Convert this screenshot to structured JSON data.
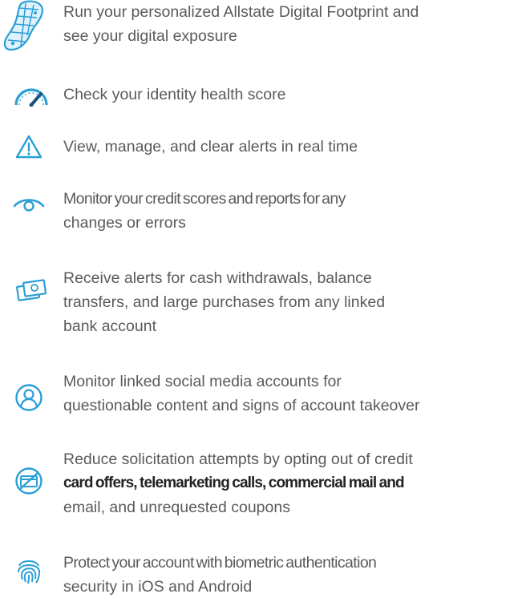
{
  "features": [
    {
      "icon": "digital-footprint-icon",
      "lines": [
        "Run your personalized Allstate Digital Footprint and",
        "see your digital exposure"
      ]
    },
    {
      "icon": "gauge-icon",
      "lines": [
        "Check your identity health score"
      ]
    },
    {
      "icon": "warning-icon",
      "lines": [
        "View, manage, and clear alerts in real time"
      ]
    },
    {
      "icon": "eye-icon",
      "lines": [
        "Monitor your credit scores and reports for any",
        "changes or errors"
      ]
    },
    {
      "icon": "cash-icon",
      "lines": [
        "Receive alerts for cash withdrawals, balance",
        "transfers, and large purchases from any linked",
        "bank account"
      ]
    },
    {
      "icon": "user-profile-icon",
      "lines": [
        "Monitor linked social media accounts for",
        "questionable content and signs of account takeover"
      ]
    },
    {
      "icon": "no-credit-card-icon",
      "lines": [
        "Reduce solicitation attempts by opting out of credit",
        "card offers, telemarketing calls, commercial mail and",
        "email, and unrequested coupons"
      ]
    },
    {
      "icon": "fingerprint-icon",
      "lines": [
        "Protect your account with biometric authentication",
        "security in iOS and Android"
      ]
    }
  ],
  "colors": {
    "icon_blue": "#2a9fd6",
    "icon_dark": "#20507a",
    "body_text": "#5a5a5a",
    "bold_text": "#232323"
  }
}
